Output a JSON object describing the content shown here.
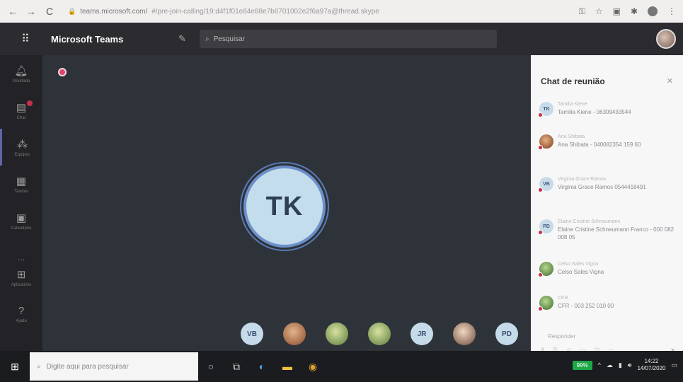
{
  "browser": {
    "url_domain": "teams.microsoft.com/",
    "url_rest": "#/pre-join-calling/19:d4f1f01e84e88e7b6701002e2f6a97a@thread.skype",
    "nav_back": "←",
    "nav_forward": "→",
    "nav_reload": "C"
  },
  "teams": {
    "app_title": "Microsoft Teams",
    "search_placeholder": "Pesquisar"
  },
  "rail": {
    "items": [
      {
        "label": "Atividade",
        "icon": "bell-icon"
      },
      {
        "label": "Chat",
        "icon": "chat-icon"
      },
      {
        "label": "Equipes",
        "icon": "teams-icon"
      },
      {
        "label": "Tarefas",
        "icon": "assignments-icon"
      },
      {
        "label": "Calendário",
        "icon": "calendar-icon"
      },
      {
        "label": "...",
        "icon": "more-icon"
      }
    ],
    "bottom": [
      {
        "label": "Aplicativos",
        "icon": "apps-icon"
      },
      {
        "label": "Ajuda",
        "icon": "help-icon"
      }
    ]
  },
  "stage": {
    "main_initials": "TK",
    "participants": [
      {
        "initials": "VB"
      },
      {
        "initials": ""
      },
      {
        "initials": ""
      },
      {
        "initials": ""
      },
      {
        "initials": "JR"
      },
      {
        "initials": ""
      },
      {
        "initials": "PD"
      }
    ]
  },
  "chat": {
    "title": "Chat de reunião",
    "messages": [
      {
        "initials": "TK",
        "name": "Tamilia Kiene",
        "text": "Tamilia Kiene - 06309433544"
      },
      {
        "initials": "",
        "name": "Ana Shibata",
        "text": "Ana Shibata - 040082354 159 60"
      },
      {
        "initials": "VB",
        "name": "Virginia Grace Ramos",
        "text": "Virginia Grace Ramos 0544418491"
      },
      {
        "initials": "PD",
        "name": "Elaine Cristine Schneumann",
        "text": "Elaine Cristine Schneumann Franco - 000 082 008 05"
      },
      {
        "initials": "",
        "name": "Celso Sales Vigna",
        "text": "Celso Sales Vigna"
      },
      {
        "initials": "",
        "name": "CFR",
        "text": "CFR - 003 252 010 00"
      }
    ],
    "reply_label": "Responder"
  },
  "taskbar": {
    "search_placeholder": "Digite aqui para pesquisar",
    "battery": "99%",
    "time": "14:22",
    "date": "14/07/2020"
  }
}
